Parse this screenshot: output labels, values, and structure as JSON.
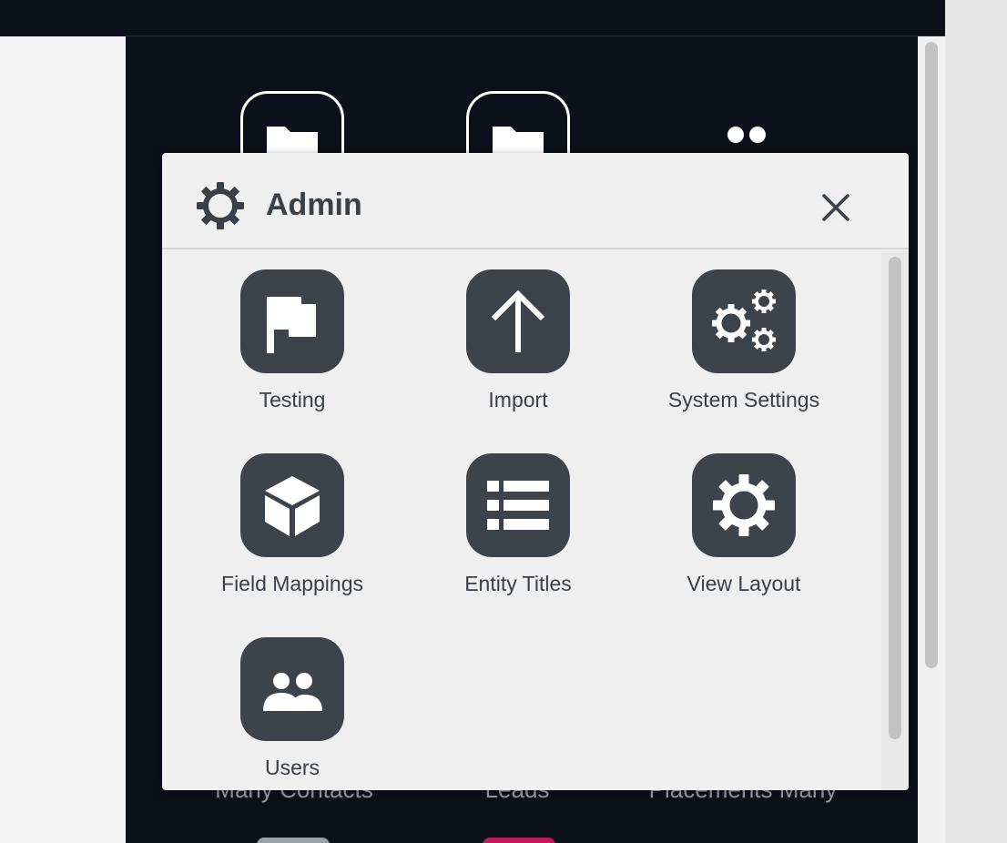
{
  "modal": {
    "title": "Admin",
    "icon": "gear-icon",
    "close_icon": "close-icon",
    "tiles": [
      {
        "label": "Testing",
        "icon": "flag-icon"
      },
      {
        "label": "Import",
        "icon": "arrow-up-icon"
      },
      {
        "label": "System Settings",
        "icon": "gears-icon"
      },
      {
        "label": "Field Mappings",
        "icon": "cube-icon"
      },
      {
        "label": "Entity Titles",
        "icon": "list-icon"
      },
      {
        "label": "View Layout",
        "icon": "gear-icon"
      },
      {
        "label": "Users",
        "icon": "users-icon"
      }
    ]
  },
  "background": {
    "labels": [
      "Many Contacts",
      "Leads",
      "Placements Many"
    ],
    "icons": [
      "folder-icon",
      "folder-icon",
      "people-icon"
    ]
  },
  "colors": {
    "app_background": "#0b101a",
    "modal_background": "#efefef",
    "tile_background": "#3d434b",
    "text": "#3a4048"
  }
}
